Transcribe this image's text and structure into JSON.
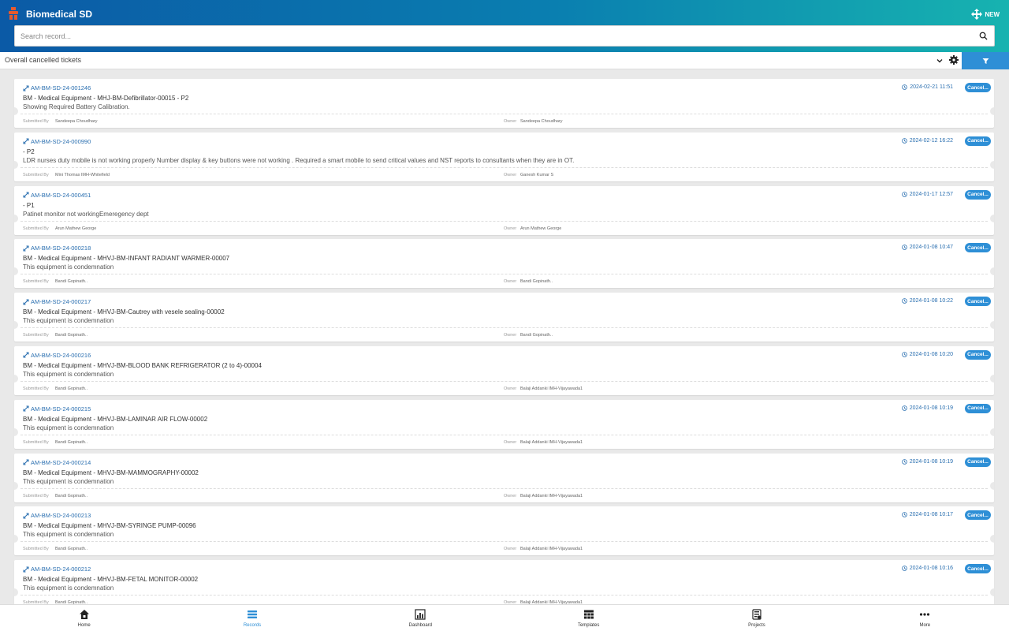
{
  "app": {
    "title": "Biomedical SD",
    "new_label": "NEW"
  },
  "search": {
    "placeholder": "Search record..."
  },
  "filterbar": {
    "view_name": "Overall cancelled tickets"
  },
  "colors": {
    "accent": "#2e8fd6",
    "link": "#2a6fb0",
    "header_start": "#0b5aa6",
    "header_end": "#17b3b0"
  },
  "labels": {
    "submitted_by": "Submitted By",
    "owner": "Owner"
  },
  "records": [
    {
      "id": "AM-BM-SD-24-001246",
      "title": "BM - Medical Equipment - MHJ-BM-Defibrillator-00015 - P2",
      "desc": "Showing Required Battery Calibration.",
      "submitted_by": "Sandeepa Choudhary",
      "owner": "Sandeepa Choudhary",
      "date": "2024-02-21 11:51",
      "status": "Cancel..."
    },
    {
      "id": "AM-BM-SD-24-000990",
      "title": "- P2",
      "desc": "LDR nurses duty mobile is not working properly Number display & key buttons were not working . Required a smart mobile to send critical values and NST reports to consultants when they are in OT.",
      "submitted_by": "Mini Thomas IMH-Whitefield",
      "owner": "Ganesh Kumar S",
      "date": "2024-02-12 16:22",
      "status": "Cancel..."
    },
    {
      "id": "AM-BM-SD-24-000451",
      "title": "- P1",
      "desc": "Patinet monitor not workingEmeregency dept",
      "submitted_by": "Arun Mathew George",
      "owner": "Arun Mathew George",
      "date": "2024-01-17 12:57",
      "status": "Cancel..."
    },
    {
      "id": "AM-BM-SD-24-000218",
      "title": "BM - Medical Equipment - MHVJ-BM-INFANT RADIANT WARMER-00007",
      "desc": "This equipment is condemnation",
      "submitted_by": "Bandi Gopinath..",
      "owner": "Bandi Gopinath..",
      "date": "2024-01-08 10:47",
      "status": "Cancel..."
    },
    {
      "id": "AM-BM-SD-24-000217",
      "title": "BM - Medical Equipment - MHVJ-BM-Cautrey with vesele sealing-00002",
      "desc": "This equipment is condemnation",
      "submitted_by": "Bandi Gopinath..",
      "owner": "Bandi Gopinath..",
      "date": "2024-01-08 10:22",
      "status": "Cancel..."
    },
    {
      "id": "AM-BM-SD-24-000216",
      "title": "BM - Medical Equipment - MHVJ-BM-BLOOD BANK REFRIGERATOR (2 to 4)-00004",
      "desc": "This equipment is condemnation",
      "submitted_by": "Bandi Gopinath..",
      "owner": "Balaji Addanki IMH-Vijayawada1",
      "date": "2024-01-08 10:20",
      "status": "Cancel..."
    },
    {
      "id": "AM-BM-SD-24-000215",
      "title": "BM - Medical Equipment - MHVJ-BM-LAMINAR AIR FLOW-00002",
      "desc": "This equipment is condemnation",
      "submitted_by": "Bandi Gopinath..",
      "owner": "Balaji Addanki IMH-Vijayawada1",
      "date": "2024-01-08 10:19",
      "status": "Cancel..."
    },
    {
      "id": "AM-BM-SD-24-000214",
      "title": "BM - Medical Equipment - MHVJ-BM-MAMMOGRAPHY-00002",
      "desc": "This equipment is condemnation",
      "submitted_by": "Bandi Gopinath..",
      "owner": "Balaji Addanki IMH-Vijayawada1",
      "date": "2024-01-08 10:19",
      "status": "Cancel..."
    },
    {
      "id": "AM-BM-SD-24-000213",
      "title": "BM - Medical Equipment - MHVJ-BM-SYRINGE PUMP-00096",
      "desc": "This equipment is condemnation",
      "submitted_by": "Bandi Gopinath..",
      "owner": "Balaji Addanki IMH-Vijayawada1",
      "date": "2024-01-08 10:17",
      "status": "Cancel..."
    },
    {
      "id": "AM-BM-SD-24-000212",
      "title": "BM - Medical Equipment - MHVJ-BM-FETAL MONITOR-00002",
      "desc": "This equipment is condemnation",
      "submitted_by": "Bandi Gopinath..",
      "owner": "Balaji Addanki IMH-Vijayawada1",
      "date": "2024-01-08 10:16",
      "status": "Cancel..."
    }
  ],
  "nav": [
    {
      "label": "Home",
      "icon": "home-icon"
    },
    {
      "label": "Records",
      "icon": "records-icon",
      "active": true
    },
    {
      "label": "Dashboard",
      "icon": "dashboard-icon"
    },
    {
      "label": "Templates",
      "icon": "templates-icon"
    },
    {
      "label": "Projects",
      "icon": "projects-icon"
    },
    {
      "label": "More",
      "icon": "more-icon"
    }
  ]
}
